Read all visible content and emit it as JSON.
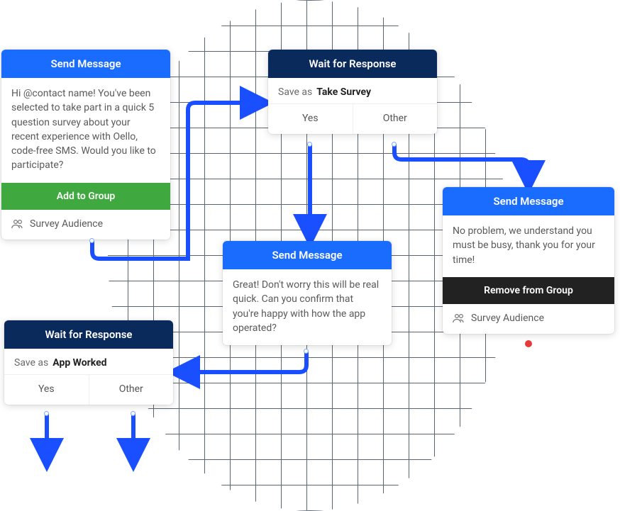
{
  "colors": {
    "primary_blue": "#1a6cff",
    "navy": "#0a2a5c",
    "green": "#3fa93f",
    "dark": "#222222",
    "arrow": "#1a4fff",
    "grid": "#d2d5da",
    "port_red": "#e63939"
  },
  "nodes": {
    "msg1": {
      "header": "Send Message",
      "body": "Hi @contact name! You've been selected to take part in a quick 5 question survey about your recent experience with Oello, code-free SMS. Would you like to participate?",
      "action_bar": "Add to Group",
      "group": "Survey Audience"
    },
    "wait1": {
      "header": "Wait for Response",
      "save_as_label": "Save as",
      "save_as_value": "Take Survey",
      "options": [
        "Yes",
        "Other"
      ]
    },
    "msg2": {
      "header": "Send Message",
      "body": "Great! Don't worry this will be real quick. Can you confirm that you're happy with how the app operated?"
    },
    "msg3": {
      "header": "Send Message",
      "body": "No problem, we understand you must be busy, thank you for your time!",
      "action_bar": "Remove from Group",
      "group": "Survey Audience"
    },
    "wait2": {
      "header": "Wait for Response",
      "save_as_label": "Save as",
      "save_as_value": "App Worked",
      "options": [
        "Yes",
        "Other"
      ]
    }
  }
}
